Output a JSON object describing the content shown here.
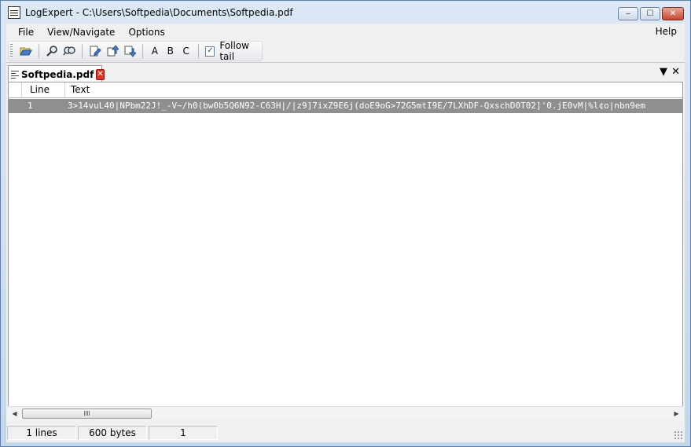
{
  "window": {
    "title": "LogExpert - C:\\Users\\Softpedia\\Documents\\Softpedia.pdf",
    "controls": {
      "minimize": "‒",
      "maximize": "☐",
      "close": "✕"
    }
  },
  "menu": {
    "file": "File",
    "view_navigate": "View/Navigate",
    "options": "Options",
    "help": "Help"
  },
  "toolbar": {
    "icons": [
      "open-folder-icon",
      "search-icon",
      "search-filter-icon",
      "bookmark-edit-icon",
      "bookmark-prev-icon",
      "bookmark-next-icon"
    ],
    "highlight_a": "A",
    "highlight_b": "B",
    "highlight_c": "C",
    "follow_tail_label": "Follow tail",
    "follow_tail_checked": true
  },
  "tabs": [
    {
      "label": "Softpedia.pdf",
      "active": true
    }
  ],
  "tab_controls": {
    "menu": "▼",
    "close": "✕"
  },
  "grid": {
    "columns": [
      "Line",
      "Text"
    ],
    "rows": [
      {
        "line": "1",
        "text": "3>14vuL40|NPbm22J!_-V~/h0(bw0b5Q6N92-C63H|/|z9]7ixZ9E6j(doE9oG>72G5mtI9E/7LXhDF-QxschD0T02]'0.jE0vM|%l¢o|nbn9em"
      }
    ],
    "selected_row_color": "#8f8f8f"
  },
  "scrollbar": {
    "left_arrow": "◀",
    "right_arrow": "▶"
  },
  "status": {
    "lines": "1 lines",
    "size": "600 bytes",
    "position": "1"
  }
}
